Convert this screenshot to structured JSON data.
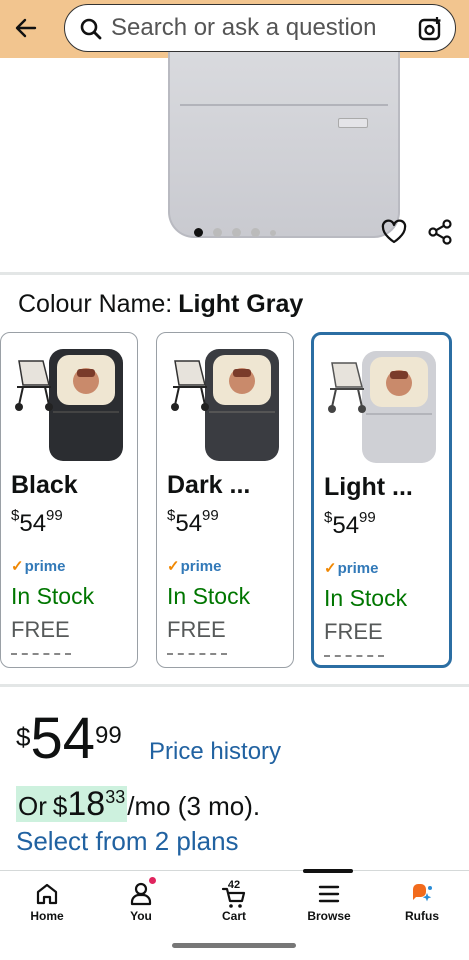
{
  "search": {
    "placeholder": "Search or ask a question"
  },
  "gallery": {
    "image_count": 5,
    "active_index": 0
  },
  "colour": {
    "label": "Colour Name:",
    "selected": "Light Gray"
  },
  "variants": [
    {
      "name": "Black",
      "currency": "$",
      "price_whole": "54",
      "price_fraction": "99",
      "prime": "prime",
      "stock": "In Stock",
      "shipping": "FREE",
      "selected": false
    },
    {
      "name": "Dark ...",
      "currency": "$",
      "price_whole": "54",
      "price_fraction": "99",
      "prime": "prime",
      "stock": "In Stock",
      "shipping": "FREE",
      "selected": false
    },
    {
      "name": "Light ...",
      "currency": "$",
      "price_whole": "54",
      "price_fraction": "99",
      "prime": "prime",
      "stock": "In Stock",
      "shipping": "FREE",
      "selected": true
    }
  ],
  "price": {
    "currency": "$",
    "whole": "54",
    "fraction": "99",
    "history_link": "Price history"
  },
  "installment": {
    "prefix": "Or",
    "currency": "$",
    "whole": "18",
    "fraction": "33",
    "suffix": "/mo (3 mo).",
    "plans_link": "Select from 2 plans"
  },
  "nav": {
    "items": [
      {
        "label": "Home",
        "icon": "home-icon"
      },
      {
        "label": "You",
        "icon": "user-icon"
      },
      {
        "label": "Cart",
        "icon": "cart-icon"
      },
      {
        "label": "Browse",
        "icon": "menu-icon"
      },
      {
        "label": "Rufus",
        "icon": "rufus-icon"
      }
    ],
    "cart_count": "42"
  },
  "colors": {
    "header_bg": "#f2c58f",
    "link": "#2162a1",
    "in_stock": "#007600",
    "selected_border": "#2b6ea3",
    "prime_blue": "#3279b8",
    "prime_check": "#f08804",
    "installment_highlight": "#cdf1de"
  }
}
